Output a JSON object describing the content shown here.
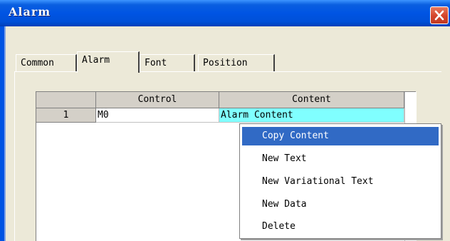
{
  "window": {
    "title": "Alarm"
  },
  "tabs": [
    "Common",
    "Alarm",
    "Font",
    "Position"
  ],
  "active_tab": "Alarm",
  "grid": {
    "columns": [
      "",
      "Control",
      "Content"
    ],
    "rows": [
      {
        "index": "1",
        "control": "M0",
        "content": "Alarm Content"
      }
    ]
  },
  "context_menu": {
    "items": [
      "Copy Content",
      "New Text",
      "New Variational Text",
      "New Data",
      "Delete"
    ],
    "highlighted": "Copy Content"
  },
  "colors": {
    "titlebar": "#0054E3",
    "selection": "#316AC5",
    "selected_cell": "#80FFFF",
    "dialog_bg": "#ECE9D8"
  }
}
